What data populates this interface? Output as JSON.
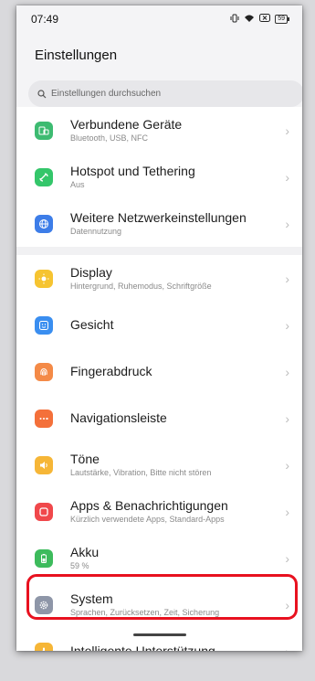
{
  "status": {
    "time": "07:49",
    "battery": "59"
  },
  "title": "Einstellungen",
  "search": {
    "placeholder": "Einstellungen durchsuchen"
  },
  "groups": [
    [
      {
        "label": "Verbundene Geräte",
        "sub": "Bluetooth, USB, NFC",
        "color": "#3dbb71",
        "icon": "connected-devices-icon"
      },
      {
        "label": "Hotspot und Tethering",
        "sub": "Aus",
        "color": "#34c66a",
        "icon": "hotspot-icon"
      },
      {
        "label": "Weitere Netzwerkeinstellungen",
        "sub": "Datennutzung",
        "color": "#3d7de8",
        "icon": "network-globe-icon"
      }
    ],
    [
      {
        "label": "Display",
        "sub": "Hintergrund, Ruhemodus, Schriftgröße",
        "color": "#f6c431",
        "icon": "sun-icon"
      },
      {
        "label": "Gesicht",
        "sub": "",
        "color": "#3a8ef0",
        "icon": "face-icon"
      },
      {
        "label": "Fingerabdruck",
        "sub": "",
        "color": "#f48a47",
        "icon": "fingerprint-icon"
      },
      {
        "label": "Navigationsleiste",
        "sub": "",
        "color": "#f4703a",
        "icon": "navigation-bar-icon"
      },
      {
        "label": "Töne",
        "sub": "Lautstärke, Vibration, Bitte nicht stören",
        "color": "#f6b637",
        "icon": "sound-icon"
      },
      {
        "label": "Apps & Benachrichtigungen",
        "sub": "Kürzlich verwendete Apps, Standard-Apps",
        "color": "#f0484b",
        "icon": "apps-icon"
      },
      {
        "label": "Akku",
        "sub": "59 %",
        "color": "#3dbb5c",
        "icon": "battery-icon"
      },
      {
        "label": "System",
        "sub": "Sprachen, Zurücksetzen, Zeit, Sicherung",
        "color": "#8e96a8",
        "icon": "system-gear-icon"
      },
      {
        "label": "Intelligente Unterstützung",
        "sub": "",
        "color": "#f6b637",
        "icon": "smart-assist-icon"
      }
    ]
  ]
}
